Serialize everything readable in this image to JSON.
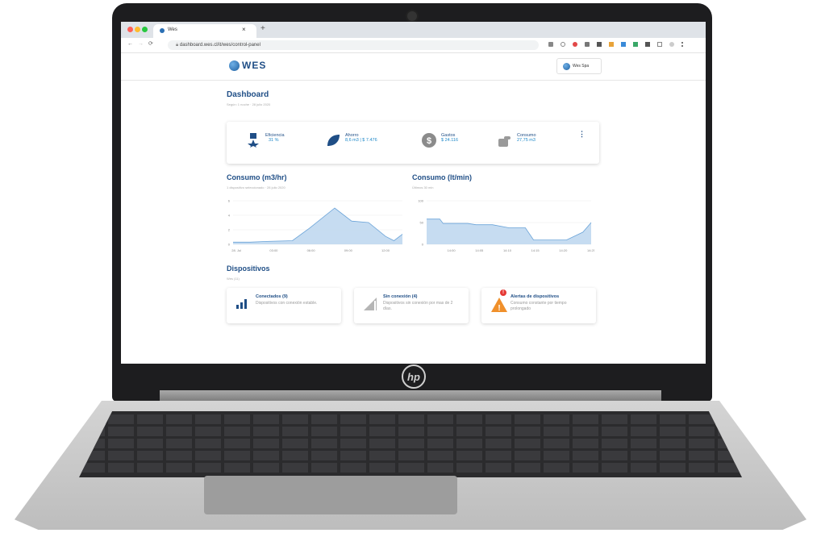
{
  "browser": {
    "tab_title": "Wes",
    "tab_close": "×",
    "new_tab": "+",
    "url": "dashboard.wes.cl/it/wes/control-panel"
  },
  "app": {
    "logo_text": "WES",
    "user_button": "Wes Spa"
  },
  "dashboard": {
    "title": "Dashboard",
    "subtitle": "Según: 1 noche · 28 julio 2020"
  },
  "kpis": [
    {
      "label": "Eficiencia",
      "value": "31 %",
      "icon": "medal-icon"
    },
    {
      "label": "Ahorro",
      "value": "8,6 m3 | $ 7.476",
      "icon": "leaf-icon"
    },
    {
      "label": "Gastos",
      "value": "$ 24.116",
      "icon": "dollar-icon"
    },
    {
      "label": "Consumo",
      "value": "27,75 m3",
      "icon": "hand-icon"
    }
  ],
  "kpi_menu": "⋮",
  "charts": {
    "left": {
      "title": "Consumo (m3/hr)",
      "subtitle": "1 dispositivo seleccionado · 28 julio 2020"
    },
    "right": {
      "title": "Consumo (lt/min)",
      "subtitle": "Últimos 30 min"
    }
  },
  "chart_data": [
    {
      "type": "area",
      "title": "Consumo (m3/hr)",
      "x": [
        "28. Jul",
        "03:00",
        "06:00",
        "09:00",
        "12:00"
      ],
      "yticks": [
        0,
        2,
        4,
        6
      ],
      "ylim": [
        0,
        6
      ],
      "points": [
        [
          0,
          0.3
        ],
        [
          0.1,
          0.3
        ],
        [
          0.2,
          0.4
        ],
        [
          0.35,
          0.5
        ],
        [
          0.45,
          2.2
        ],
        [
          0.6,
          5.0
        ],
        [
          0.7,
          3.2
        ],
        [
          0.8,
          3.0
        ],
        [
          0.9,
          1.1
        ],
        [
          0.95,
          0.5
        ],
        [
          1.0,
          1.4
        ]
      ]
    },
    {
      "type": "area",
      "title": "Consumo (lt/min)",
      "x": [
        "14:00",
        "14:05",
        "14:10",
        "14:15",
        "14:20",
        "14:25"
      ],
      "yticks": [
        0,
        50,
        100
      ],
      "ylim": [
        0,
        100
      ],
      "points": [
        [
          0,
          58
        ],
        [
          0.08,
          58
        ],
        [
          0.1,
          48
        ],
        [
          0.25,
          48
        ],
        [
          0.3,
          45
        ],
        [
          0.4,
          45
        ],
        [
          0.5,
          38
        ],
        [
          0.6,
          38
        ],
        [
          0.65,
          10
        ],
        [
          0.85,
          10
        ],
        [
          0.95,
          28
        ],
        [
          1.0,
          50
        ]
      ]
    }
  ],
  "devices": {
    "title": "Dispositivos",
    "subtitle": "Wes (11)",
    "cards": [
      {
        "title": "Conectados (9)",
        "desc": "Dispositivos con conexión estable.",
        "icon": "signal-bars-icon"
      },
      {
        "title": "Sin conexión (4)",
        "desc": "Dispositivos sin conexión por mas de 2 días.",
        "icon": "no-signal-icon"
      },
      {
        "title": "Alertas de dispositivos",
        "desc": "Consumo constante por tiempo prolongado",
        "icon": "warning-icon",
        "badge": "!"
      }
    ]
  },
  "colors": {
    "primary": "#1f4e86",
    "accent": "#1e88c8",
    "chart_fill": "#bcd6ef",
    "warning": "#f0902b"
  }
}
